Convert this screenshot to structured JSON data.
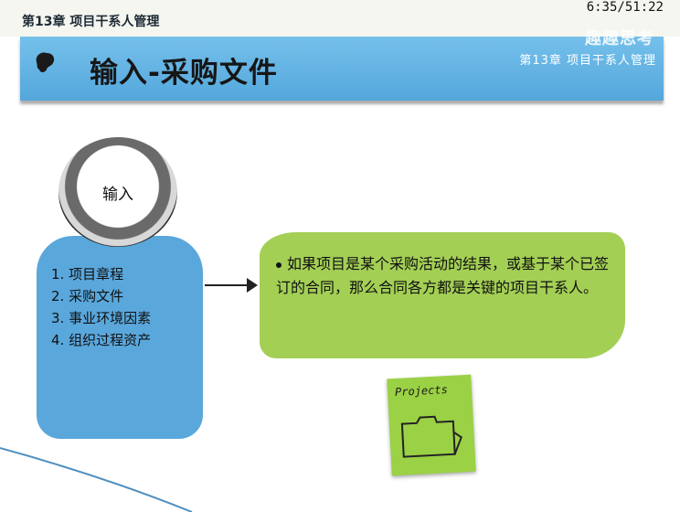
{
  "header": {
    "chapter_top": "第13章 项目干系人管理",
    "timer": "6:35/51:22"
  },
  "banner": {
    "title": "输入-采购文件",
    "brand": "趣趣思考",
    "chapter": "第13章 项目干系人管理",
    "logo_icon": "brain-icon"
  },
  "circle": {
    "label": "输入"
  },
  "inputs": {
    "items": [
      "1. 项目章程",
      "2. 采购文件",
      "3. 事业环境因素",
      "4. 组织过程资产"
    ]
  },
  "bubble": {
    "text": "如果项目是某个采购活动的结果，或基于某个已签订的合同，那么合同各方都是关键的项目干系人。"
  },
  "note": {
    "label": "Projects",
    "icon": "folder-icon"
  },
  "colors": {
    "banner": "#5aa7dc",
    "panel": "#5aa7dc",
    "bubble": "#a3cf55",
    "note": "#9bd145"
  }
}
